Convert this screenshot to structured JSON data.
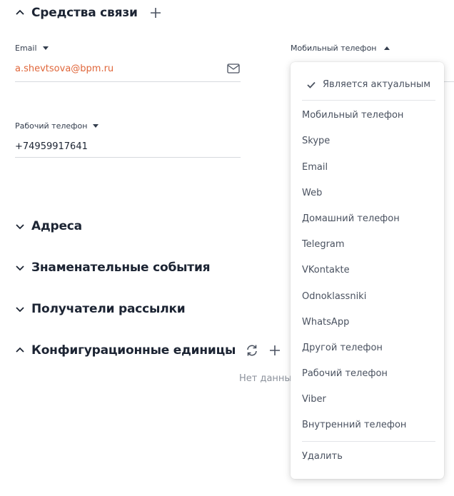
{
  "sections": {
    "contacts": {
      "title": "Средства связи"
    },
    "addresses": {
      "title": "Адреса"
    },
    "events": {
      "title": "Знаменательные события"
    },
    "recipients": {
      "title": "Получатели рассылки"
    },
    "config_items": {
      "title": "Конфигурационные единицы",
      "empty_text": "Нет данных"
    }
  },
  "fields": {
    "email": {
      "label": "Email",
      "value": "a.shevtsova@bpm.ru"
    },
    "mobile": {
      "label": "Мобильный телефон"
    },
    "work_phone": {
      "label": "Рабочий телефон",
      "value": "+74959917641"
    }
  },
  "dropdown": {
    "actual_label": "Является актуальным",
    "options": [
      "Мобильный телефон",
      "Skype",
      "Email",
      "Web",
      "Домашний телефон",
      "Telegram",
      "VKontakte",
      "Odnoklassniki",
      "WhatsApp",
      "Другой телефон",
      "Рабочий телефон",
      "Viber",
      "Внутренний телефон"
    ],
    "delete_label": "Удалить"
  },
  "colors": {
    "email_link": "#e0663a",
    "text": "#1c2433",
    "muted": "#8c929c"
  },
  "icons": [
    "chevron-up-icon",
    "chevron-down-icon",
    "plus-icon",
    "envelope-icon",
    "refresh-icon",
    "more-icon",
    "check-icon"
  ]
}
